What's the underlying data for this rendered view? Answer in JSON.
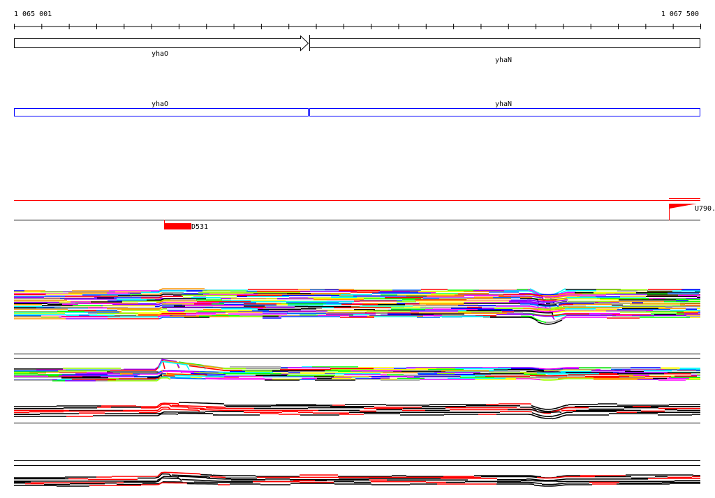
{
  "ruler": {
    "start_label": "1 065 001",
    "end_label": "1 067 500",
    "start": 1065001,
    "end": 1067500,
    "tick_interval_bp": 100
  },
  "genes": [
    {
      "name": "yhaO",
      "strand": "+",
      "start": 1065001,
      "end": 1066075
    },
    {
      "name": "yhaN",
      "strand": "-",
      "start": 1066080,
      "end": 1067500
    }
  ],
  "annotations": [
    {
      "name": "yhaO",
      "start": 1065001,
      "end": 1066075
    },
    {
      "name": "yhaN",
      "start": 1066080,
      "end": 1067500
    }
  ],
  "features": {
    "upstream_label": "U790.",
    "downstream_label": "D531"
  },
  "colors": {
    "gene_outline": "#000000",
    "annotation": "#0000ff",
    "feature": "#ff0000",
    "track_palette": [
      "#000000",
      "#ff0000",
      "#ff00ff",
      "#00ff00",
      "#0066ff",
      "#00ffff",
      "#ffff00",
      "#999999",
      "#ff9900",
      "#9900ff",
      "#99ff00",
      "#0000ff"
    ]
  }
}
